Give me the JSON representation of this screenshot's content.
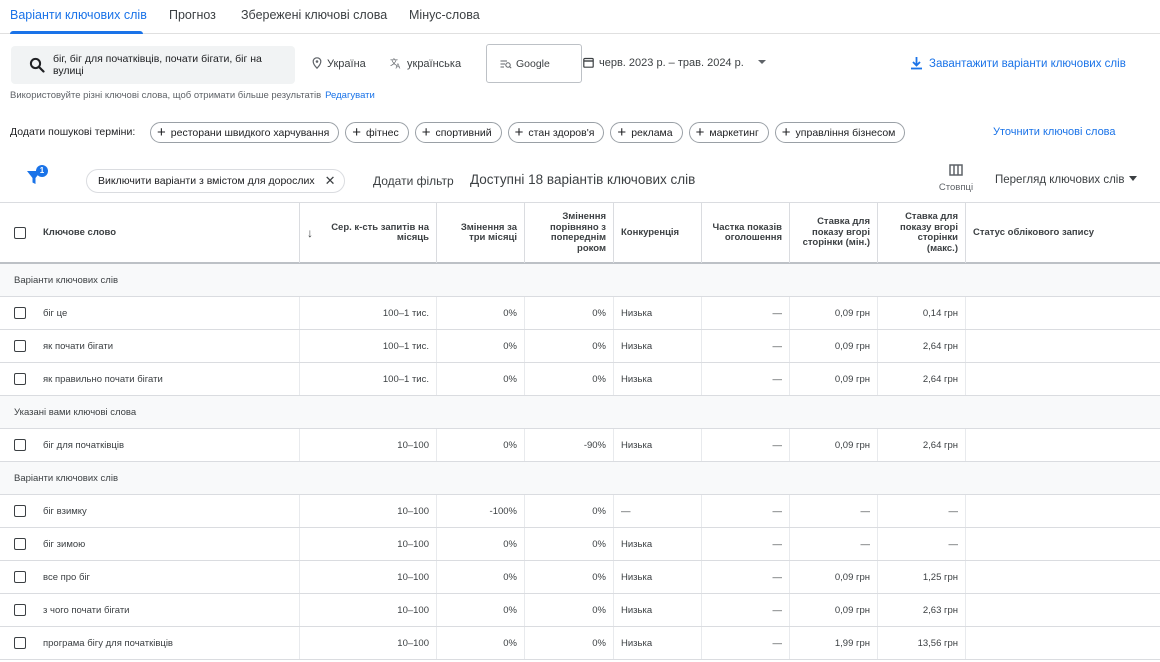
{
  "tabs": [
    "Варіанти ключових слів",
    "Прогноз",
    "Збережені ключові слова",
    "Мінус-слова"
  ],
  "search": {
    "query": "біг, біг для початківців, почати бігати, біг на вулиці",
    "location": "Україна",
    "language": "українська",
    "engine": "Google",
    "date_range": "черв. 2023 р. – трав. 2024 р.",
    "download_label": "Завантажити варіанти ключових слів",
    "hint": "Використовуйте різні ключові слова, щоб отримати більше результатів",
    "edit_label": "Редагувати"
  },
  "add_terms": {
    "label": "Додати пошукові терміни:",
    "chips": [
      "ресторани швидкого харчування",
      "фітнес",
      "спортивний",
      "стан здоров'я",
      "реклама",
      "маркетинг",
      "управління бізнесом"
    ],
    "refine_label": "Уточнити ключові слова"
  },
  "filter_bar": {
    "badge": "1",
    "active_filter": "Виключити варіанти з вмістом для дорослих",
    "add_filter": "Додати фільтр",
    "available": "Доступні 18 варіантів ключових слів",
    "columns_label": "Стовпці",
    "view_label": "Перегляд ключових слів"
  },
  "table": {
    "headers": {
      "keyword": "Ключове слово",
      "avg": "Сер. к-сть запитів на місяць",
      "three_month": "Змінення за три місяці",
      "yoy": "Змінення порівняно з попереднім роком",
      "competition": "Конкуренція",
      "impr_share": "Частка показів оголошення",
      "bid_low": "Ставка для показу вгорі сторінки (мін.)",
      "bid_high": "Ставка для показу вгорі сторінки (макс.)",
      "status": "Статус облікового запису"
    },
    "groups": [
      {
        "label": "Варіанти ключових слів",
        "rows": [
          {
            "keyword": "біг це",
            "avg": "100–1 тис.",
            "three_month": "0%",
            "yoy": "0%",
            "competition": "Низька",
            "impr_share": "—",
            "bid_low": "0,09 грн",
            "bid_high": "0,14 грн"
          },
          {
            "keyword": "як почати бігати",
            "avg": "100–1 тис.",
            "three_month": "0%",
            "yoy": "0%",
            "competition": "Низька",
            "impr_share": "—",
            "bid_low": "0,09 грн",
            "bid_high": "2,64 грн"
          },
          {
            "keyword": "як правильно почати бігати",
            "avg": "100–1 тис.",
            "three_month": "0%",
            "yoy": "0%",
            "competition": "Низька",
            "impr_share": "—",
            "bid_low": "0,09 грн",
            "bid_high": "2,64 грн"
          }
        ]
      },
      {
        "label": "Указані вами ключові слова",
        "rows": [
          {
            "keyword": "біг для початківців",
            "avg": "10–100",
            "three_month": "0%",
            "yoy": "-90%",
            "competition": "Низька",
            "impr_share": "—",
            "bid_low": "0,09 грн",
            "bid_high": "2,64 грн"
          }
        ]
      },
      {
        "label": "Варіанти ключових слів",
        "rows": [
          {
            "keyword": "біг взимку",
            "avg": "10–100",
            "three_month": "-100%",
            "yoy": "0%",
            "competition": "—",
            "impr_share": "—",
            "bid_low": "—",
            "bid_high": "—"
          },
          {
            "keyword": "біг зимою",
            "avg": "10–100",
            "three_month": "0%",
            "yoy": "0%",
            "competition": "Низька",
            "impr_share": "—",
            "bid_low": "—",
            "bid_high": "—"
          },
          {
            "keyword": "все про біг",
            "avg": "10–100",
            "three_month": "0%",
            "yoy": "0%",
            "competition": "Низька",
            "impr_share": "—",
            "bid_low": "0,09 грн",
            "bid_high": "1,25 грн"
          },
          {
            "keyword": "з чого почати бігати",
            "avg": "10–100",
            "three_month": "0%",
            "yoy": "0%",
            "competition": "Низька",
            "impr_share": "—",
            "bid_low": "0,09 грн",
            "bid_high": "2,63 грн"
          },
          {
            "keyword": "програма бігу для початківців",
            "avg": "10–100",
            "three_month": "0%",
            "yoy": "0%",
            "competition": "Низька",
            "impr_share": "—",
            "bid_low": "1,99 грн",
            "bid_high": "13,56 грн"
          }
        ]
      }
    ]
  }
}
